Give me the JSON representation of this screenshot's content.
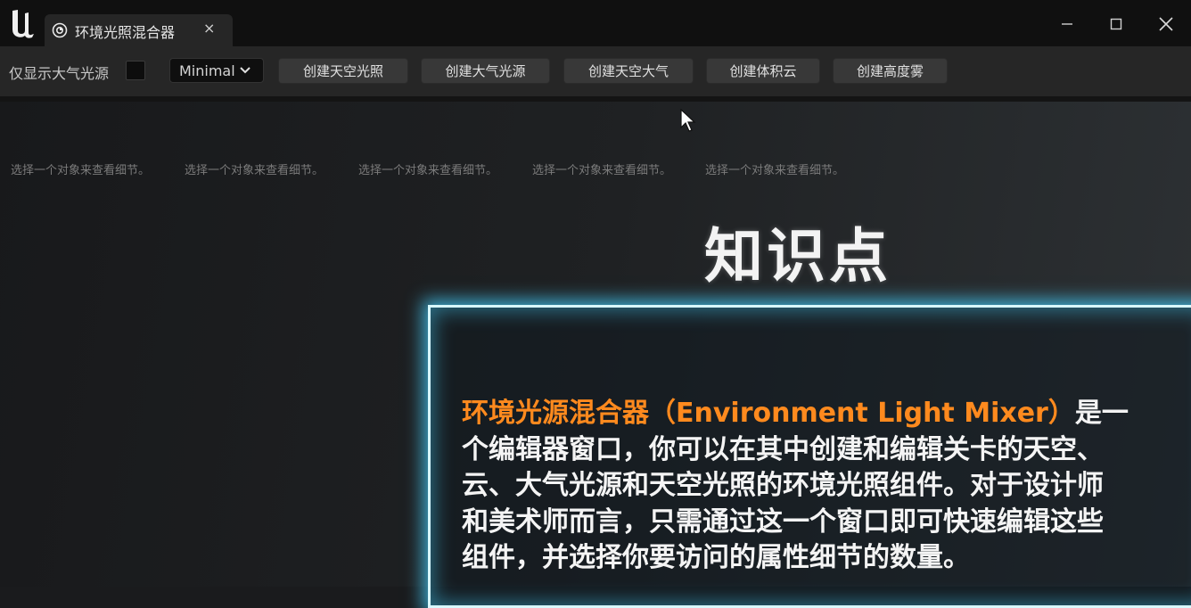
{
  "window": {
    "tab_title": "环境光照混合器",
    "tab_close": "×"
  },
  "toolbar": {
    "checkbox_label": "仅显示大气光源",
    "dropdown_value": "Minimal",
    "buttons": [
      "创建天空光照",
      "创建大气光源",
      "创建天空大气",
      "创建体积云",
      "创建高度雾"
    ]
  },
  "details": {
    "hints": [
      "选择一个对象来查看细节。",
      "选择一个对象来查看细节。",
      "选择一个对象来查看细节。",
      "选择一个对象来查看细节。",
      "选择一个对象来查看细节。"
    ]
  },
  "overlay": {
    "title": "知识点",
    "highlight": "环境光源混合器（Environment Light Mixer）",
    "line1_tail": "是一",
    "lines": [
      "个编辑器窗口，你可以在其中创建和编辑关卡的天空、",
      "云、大气光源和天空光照的环境光照组件。对于设计师",
      "和美术师而言，只需通过这一个窗口即可快速编辑这些",
      "组件，并选择你要访问的属性细节的数量。"
    ]
  },
  "colors": {
    "highlight": "#ff8a1e",
    "glow": "#46d2ff"
  },
  "icons": [
    "unreal-logo-icon",
    "light-mixer-icon",
    "minimize-icon",
    "maximize-icon",
    "close-icon",
    "chevron-down-icon",
    "mouse-cursor-icon"
  ]
}
